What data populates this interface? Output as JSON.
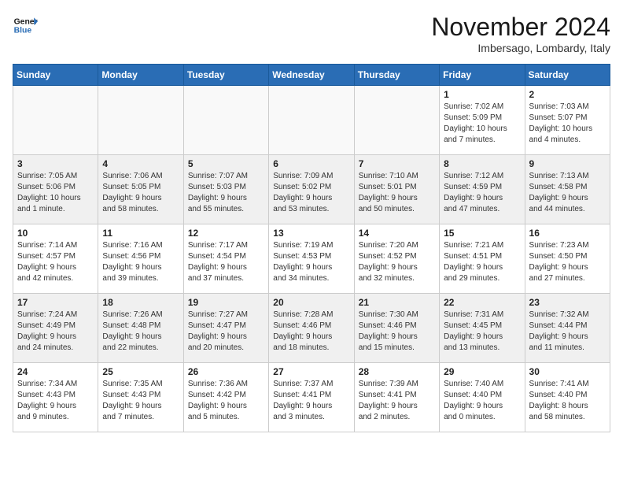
{
  "header": {
    "logo_general": "General",
    "logo_blue": "Blue",
    "month": "November 2024",
    "location": "Imbersago, Lombardy, Italy"
  },
  "weekdays": [
    "Sunday",
    "Monday",
    "Tuesday",
    "Wednesday",
    "Thursday",
    "Friday",
    "Saturday"
  ],
  "rows": [
    [
      {
        "day": "",
        "info": ""
      },
      {
        "day": "",
        "info": ""
      },
      {
        "day": "",
        "info": ""
      },
      {
        "day": "",
        "info": ""
      },
      {
        "day": "",
        "info": ""
      },
      {
        "day": "1",
        "info": "Sunrise: 7:02 AM\nSunset: 5:09 PM\nDaylight: 10 hours\nand 7 minutes."
      },
      {
        "day": "2",
        "info": "Sunrise: 7:03 AM\nSunset: 5:07 PM\nDaylight: 10 hours\nand 4 minutes."
      }
    ],
    [
      {
        "day": "3",
        "info": "Sunrise: 7:05 AM\nSunset: 5:06 PM\nDaylight: 10 hours\nand 1 minute."
      },
      {
        "day": "4",
        "info": "Sunrise: 7:06 AM\nSunset: 5:05 PM\nDaylight: 9 hours\nand 58 minutes."
      },
      {
        "day": "5",
        "info": "Sunrise: 7:07 AM\nSunset: 5:03 PM\nDaylight: 9 hours\nand 55 minutes."
      },
      {
        "day": "6",
        "info": "Sunrise: 7:09 AM\nSunset: 5:02 PM\nDaylight: 9 hours\nand 53 minutes."
      },
      {
        "day": "7",
        "info": "Sunrise: 7:10 AM\nSunset: 5:01 PM\nDaylight: 9 hours\nand 50 minutes."
      },
      {
        "day": "8",
        "info": "Sunrise: 7:12 AM\nSunset: 4:59 PM\nDaylight: 9 hours\nand 47 minutes."
      },
      {
        "day": "9",
        "info": "Sunrise: 7:13 AM\nSunset: 4:58 PM\nDaylight: 9 hours\nand 44 minutes."
      }
    ],
    [
      {
        "day": "10",
        "info": "Sunrise: 7:14 AM\nSunset: 4:57 PM\nDaylight: 9 hours\nand 42 minutes."
      },
      {
        "day": "11",
        "info": "Sunrise: 7:16 AM\nSunset: 4:56 PM\nDaylight: 9 hours\nand 39 minutes."
      },
      {
        "day": "12",
        "info": "Sunrise: 7:17 AM\nSunset: 4:54 PM\nDaylight: 9 hours\nand 37 minutes."
      },
      {
        "day": "13",
        "info": "Sunrise: 7:19 AM\nSunset: 4:53 PM\nDaylight: 9 hours\nand 34 minutes."
      },
      {
        "day": "14",
        "info": "Sunrise: 7:20 AM\nSunset: 4:52 PM\nDaylight: 9 hours\nand 32 minutes."
      },
      {
        "day": "15",
        "info": "Sunrise: 7:21 AM\nSunset: 4:51 PM\nDaylight: 9 hours\nand 29 minutes."
      },
      {
        "day": "16",
        "info": "Sunrise: 7:23 AM\nSunset: 4:50 PM\nDaylight: 9 hours\nand 27 minutes."
      }
    ],
    [
      {
        "day": "17",
        "info": "Sunrise: 7:24 AM\nSunset: 4:49 PM\nDaylight: 9 hours\nand 24 minutes."
      },
      {
        "day": "18",
        "info": "Sunrise: 7:26 AM\nSunset: 4:48 PM\nDaylight: 9 hours\nand 22 minutes."
      },
      {
        "day": "19",
        "info": "Sunrise: 7:27 AM\nSunset: 4:47 PM\nDaylight: 9 hours\nand 20 minutes."
      },
      {
        "day": "20",
        "info": "Sunrise: 7:28 AM\nSunset: 4:46 PM\nDaylight: 9 hours\nand 18 minutes."
      },
      {
        "day": "21",
        "info": "Sunrise: 7:30 AM\nSunset: 4:46 PM\nDaylight: 9 hours\nand 15 minutes."
      },
      {
        "day": "22",
        "info": "Sunrise: 7:31 AM\nSunset: 4:45 PM\nDaylight: 9 hours\nand 13 minutes."
      },
      {
        "day": "23",
        "info": "Sunrise: 7:32 AM\nSunset: 4:44 PM\nDaylight: 9 hours\nand 11 minutes."
      }
    ],
    [
      {
        "day": "24",
        "info": "Sunrise: 7:34 AM\nSunset: 4:43 PM\nDaylight: 9 hours\nand 9 minutes."
      },
      {
        "day": "25",
        "info": "Sunrise: 7:35 AM\nSunset: 4:43 PM\nDaylight: 9 hours\nand 7 minutes."
      },
      {
        "day": "26",
        "info": "Sunrise: 7:36 AM\nSunset: 4:42 PM\nDaylight: 9 hours\nand 5 minutes."
      },
      {
        "day": "27",
        "info": "Sunrise: 7:37 AM\nSunset: 4:41 PM\nDaylight: 9 hours\nand 3 minutes."
      },
      {
        "day": "28",
        "info": "Sunrise: 7:39 AM\nSunset: 4:41 PM\nDaylight: 9 hours\nand 2 minutes."
      },
      {
        "day": "29",
        "info": "Sunrise: 7:40 AM\nSunset: 4:40 PM\nDaylight: 9 hours\nand 0 minutes."
      },
      {
        "day": "30",
        "info": "Sunrise: 7:41 AM\nSunset: 4:40 PM\nDaylight: 8 hours\nand 58 minutes."
      }
    ]
  ]
}
